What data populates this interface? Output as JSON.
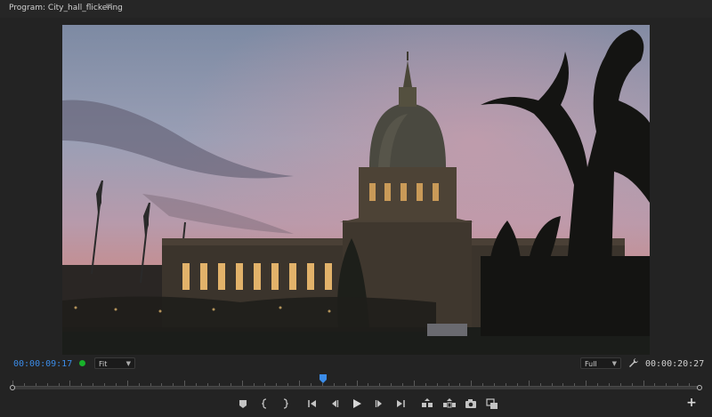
{
  "panel": {
    "title": "Program: City_hall_flickering",
    "menu_icon": "hamburger-icon"
  },
  "timecode": {
    "current": "00:00:09:17",
    "duration": "00:00:20:27"
  },
  "zoom": {
    "selected": "Fit"
  },
  "resolution": {
    "selected": "Full"
  },
  "playhead_fraction": 0.452,
  "colors": {
    "accent": "#3b8ce8",
    "status_dot": "#18b12a",
    "background": "#232323"
  },
  "controls": [
    {
      "name": "add-marker-button",
      "icon": "marker-icon"
    },
    {
      "name": "mark-in-button",
      "icon": "mark-in-icon"
    },
    {
      "name": "mark-out-button",
      "icon": "mark-out-icon"
    },
    {
      "name": "go-to-in-button",
      "icon": "go-to-in-icon"
    },
    {
      "name": "step-back-button",
      "icon": "step-back-icon"
    },
    {
      "name": "play-button",
      "icon": "play-icon"
    },
    {
      "name": "step-forward-button",
      "icon": "step-forward-icon"
    },
    {
      "name": "go-to-out-button",
      "icon": "go-to-out-icon"
    },
    {
      "name": "lift-button",
      "icon": "lift-icon"
    },
    {
      "name": "extract-button",
      "icon": "extract-icon"
    },
    {
      "name": "export-frame-button",
      "icon": "camera-icon"
    },
    {
      "name": "comparison-view-button",
      "icon": "comparison-icon"
    }
  ]
}
